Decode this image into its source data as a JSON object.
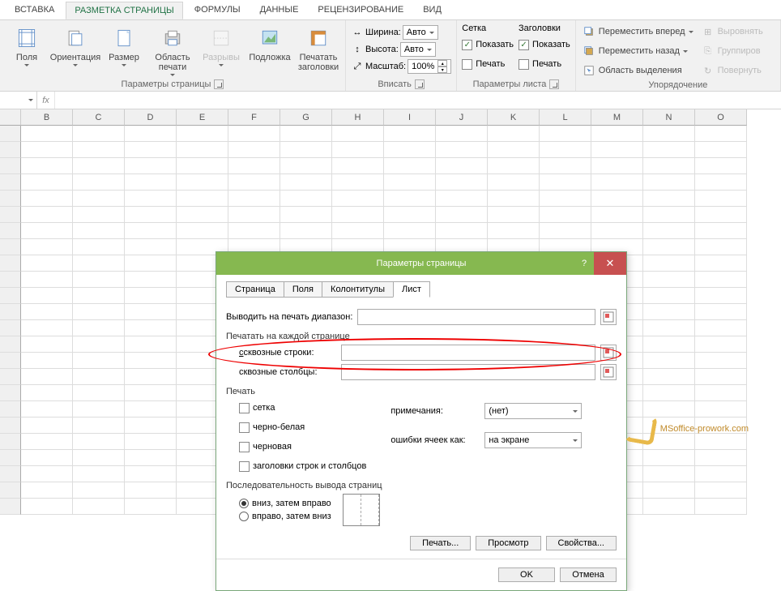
{
  "ribbon_tabs": [
    "ВСТАВКА",
    "РАЗМЕТКА СТРАНИЦЫ",
    "ФОРМУЛЫ",
    "ДАННЫЕ",
    "РЕЦЕНЗИРОВАНИЕ",
    "ВИД"
  ],
  "active_tab_idx": 1,
  "groups": {
    "page_setup": {
      "title": "Параметры страницы",
      "fields": "Поля",
      "orientation": "Ориентация",
      "size": "Размер",
      "print_area": "Область печати",
      "breaks": "Разрывы",
      "background": "Подложка",
      "print_titles": "Печатать заголовки"
    },
    "scale": {
      "title": "Вписать",
      "width_label": "Ширина:",
      "height_label": "Высота:",
      "scale_label": "Масштаб:",
      "auto": "Авто",
      "scale_val": "100%"
    },
    "sheet_opts": {
      "title": "Параметры листа",
      "gridlines": "Сетка",
      "headings": "Заголовки",
      "view": "Показать",
      "print": "Печать"
    },
    "arrange": {
      "title": "Упорядочение",
      "bring_fwd": "Переместить вперед",
      "send_back": "Переместить назад",
      "selection": "Область выделения",
      "align": "Выровнять",
      "group": "Группиров",
      "rotate": "Повернуть"
    }
  },
  "columns": [
    "B",
    "C",
    "D",
    "E",
    "F",
    "G",
    "H",
    "I",
    "J",
    "K",
    "L",
    "M",
    "N",
    "O"
  ],
  "dialog": {
    "title": "Параметры страницы",
    "tabs": [
      "Страница",
      "Поля",
      "Колонтитулы",
      "Лист"
    ],
    "active_tab_idx": 3,
    "print_range_label": "Выводить на печать диапазон:",
    "print_each_page": "Печатать на каждой странице",
    "rows_label": "сквозные строки:",
    "cols_label": "сквозные столбцы:",
    "print_section": "Печать",
    "grid_chk": "сетка",
    "bw_chk": "черно-белая",
    "draft_chk": "черновая",
    "headers_chk": "заголовки строк и столбцов",
    "comments_label": "примечания:",
    "errors_label": "ошибки ячеек как:",
    "comments_val": "(нет)",
    "errors_val": "на экране",
    "order_section": "Последовательность вывода страниц",
    "down_then_over": "вниз, затем вправо",
    "over_then_down": "вправо, затем вниз",
    "print_btn": "Печать...",
    "preview_btn": "Просмотр",
    "options_btn": "Свойства...",
    "ok": "OK",
    "cancel": "Отмена"
  },
  "watermark": "MSoffice-prowork.com"
}
